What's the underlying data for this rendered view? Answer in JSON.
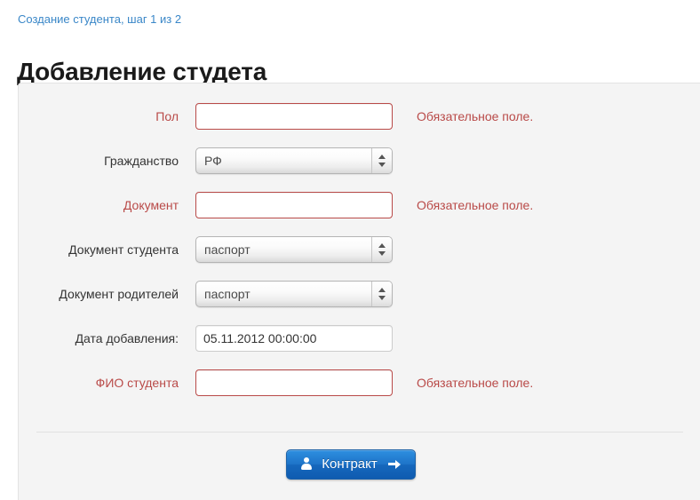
{
  "breadcrumb": {
    "text": "Создание студента, шаг 1 из 2"
  },
  "header": {
    "title": "Добавление студета"
  },
  "form": {
    "rows": [
      {
        "label": "Пол",
        "required": true,
        "control": "text",
        "value": "",
        "error": "Обязательное поле."
      },
      {
        "label": "Гражданство",
        "required": false,
        "control": "select",
        "value": "РФ",
        "error": ""
      },
      {
        "label": "Документ",
        "required": true,
        "control": "text",
        "value": "",
        "error": "Обязательное поле."
      },
      {
        "label": "Документ студента",
        "required": false,
        "control": "select",
        "value": "паспорт",
        "error": ""
      },
      {
        "label": "Документ родителей",
        "required": false,
        "control": "select",
        "value": "паспорт",
        "error": ""
      },
      {
        "label": "Дата добавления:",
        "required": false,
        "control": "text",
        "value": "05.11.2012 00:00:00",
        "error": ""
      },
      {
        "label": "ФИО студента",
        "required": true,
        "control": "text",
        "value": "",
        "error": "Обязательное поле."
      }
    ]
  },
  "footer": {
    "submit_label": "Контракт",
    "submit_leading_icon": "person-icon",
    "submit_trailing_icon": "arrow-right-icon"
  },
  "colors": {
    "link": "#3a87c8",
    "error": "#b94a48",
    "panel_bg": "#f4f4f4",
    "button_blue": "#1e73c8",
    "label": "#333333"
  }
}
